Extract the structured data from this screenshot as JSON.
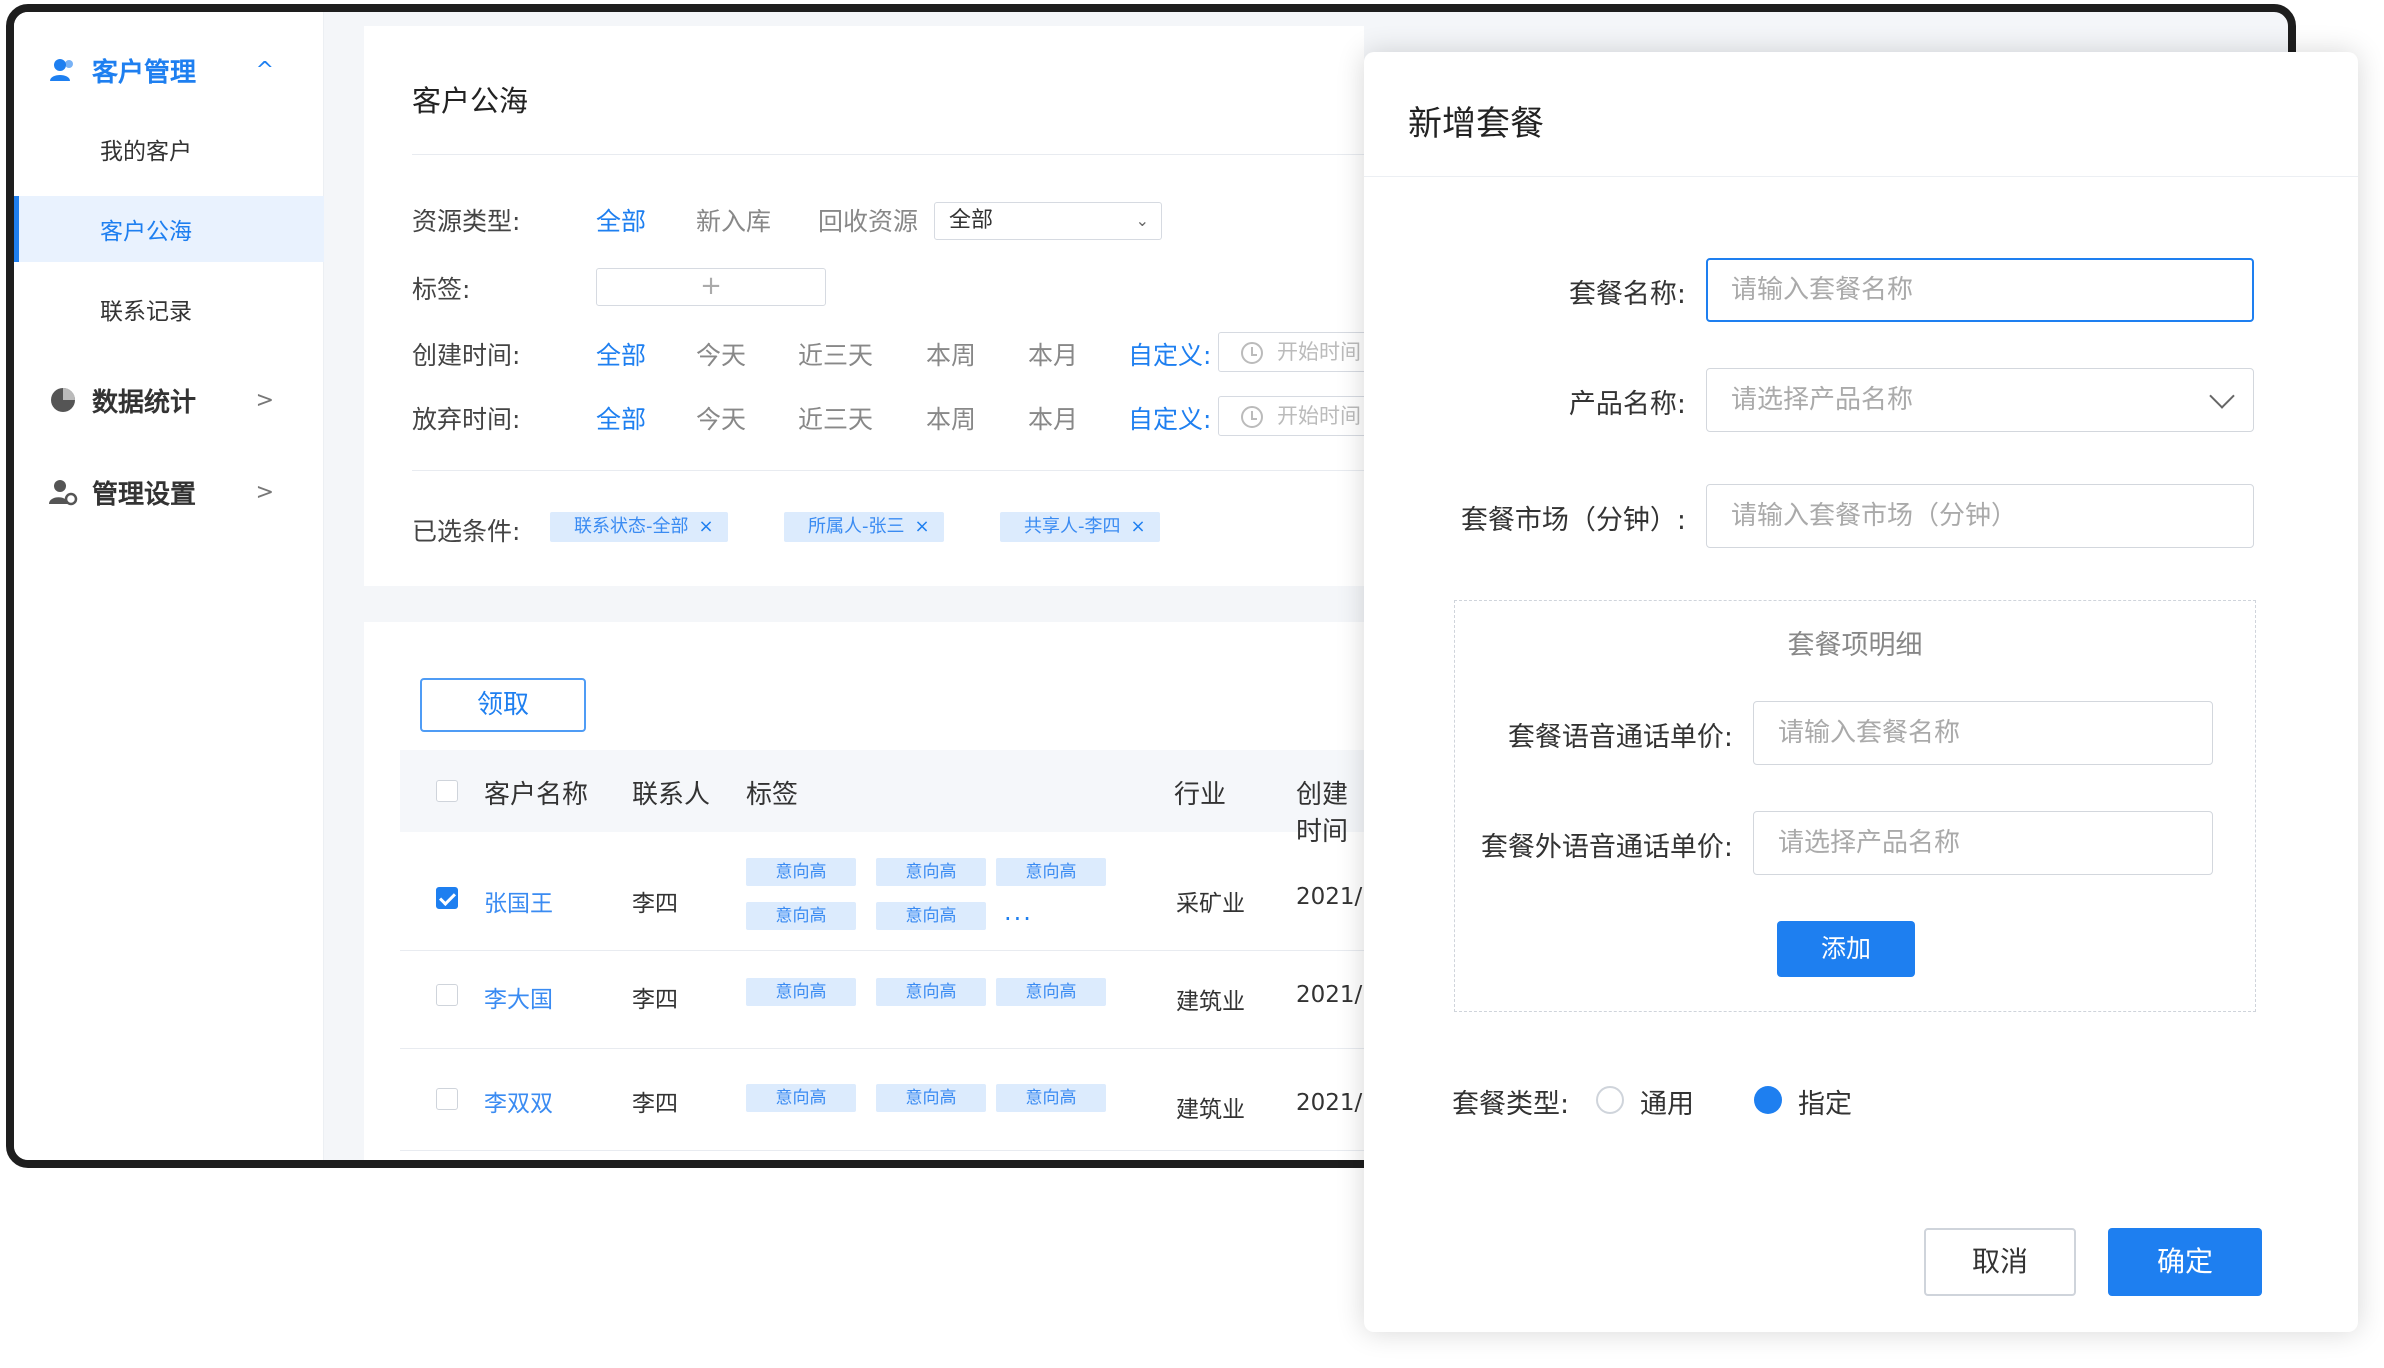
{
  "sidebar": {
    "groups": [
      {
        "label": "客户管理",
        "icon": "users-icon",
        "chevron": "^"
      },
      {
        "label": "数据统计",
        "icon": "pie-chart-icon",
        "chevron": ">"
      },
      {
        "label": "管理设置",
        "icon": "user-gear-icon",
        "chevron": ">"
      }
    ],
    "items": [
      {
        "label": "我的客户"
      },
      {
        "label": "客户公海"
      },
      {
        "label": "联系记录"
      }
    ]
  },
  "main": {
    "title": "客户公海",
    "filters": {
      "resource_type": {
        "label": "资源类型:",
        "options": [
          "全部",
          "新入库",
          "回收资源"
        ],
        "select_value": "全部"
      },
      "tags": {
        "label": "标签:",
        "add": "+"
      },
      "create_time": {
        "label": "创建时间:",
        "options": [
          "全部",
          "今天",
          "近三天",
          "本周",
          "本月"
        ],
        "custom": "自定义:",
        "start_placeholder": "开始时间"
      },
      "abandon_time": {
        "label": "放弃时间:",
        "options": [
          "全部",
          "今天",
          "近三天",
          "本周",
          "本月"
        ],
        "custom": "自定义:",
        "start_placeholder": "开始时间"
      },
      "selected": {
        "label": "已选条件:",
        "chips": [
          "联系状态-全部",
          "所属人-张三",
          "共享人-李四"
        ],
        "close": "×"
      }
    },
    "claim_button": "领取",
    "table": {
      "headers": [
        "客户名称",
        "联系人",
        "标签",
        "行业",
        "创建时间"
      ],
      "rows": [
        {
          "name": "张国王",
          "contact": "李四",
          "tags": [
            "意向高",
            "意向高",
            "意向高",
            "意向高",
            "意向高"
          ],
          "more": "...",
          "industry": "采矿业",
          "date": "2021/",
          "checked": true
        },
        {
          "name": "李大国",
          "contact": "李四",
          "tags": [
            "意向高",
            "意向高",
            "意向高"
          ],
          "industry": "建筑业",
          "date": "2021/",
          "checked": false
        },
        {
          "name": "李双双",
          "contact": "李四",
          "tags": [
            "意向高",
            "意向高",
            "意向高"
          ],
          "industry": "建筑业",
          "date": "2021/",
          "checked": false
        }
      ]
    }
  },
  "dialog": {
    "title": "新增套餐",
    "fields": [
      {
        "label": "套餐名称:",
        "placeholder": "请输入套餐名称"
      },
      {
        "label": "产品名称:",
        "placeholder": "请选择产品名称"
      },
      {
        "label": "套餐市场（分钟）:",
        "placeholder": "请输入套餐市场（分钟）"
      }
    ],
    "detail": {
      "title": "套餐项明细",
      "fields": [
        {
          "label": "套餐语音通话单价:",
          "placeholder": "请输入套餐名称"
        },
        {
          "label": "套餐外语音通话单价:",
          "placeholder": "请选择产品名称"
        }
      ],
      "add_button": "添加"
    },
    "type": {
      "label": "套餐类型:",
      "options": [
        "通用",
        "指定"
      ],
      "selected": "指定"
    },
    "cancel": "取消",
    "confirm": "确定"
  },
  "colors": {
    "accent": "#1e7ff0",
    "chip_bg": "#dcebfd",
    "frame": "#1e1e1e"
  }
}
